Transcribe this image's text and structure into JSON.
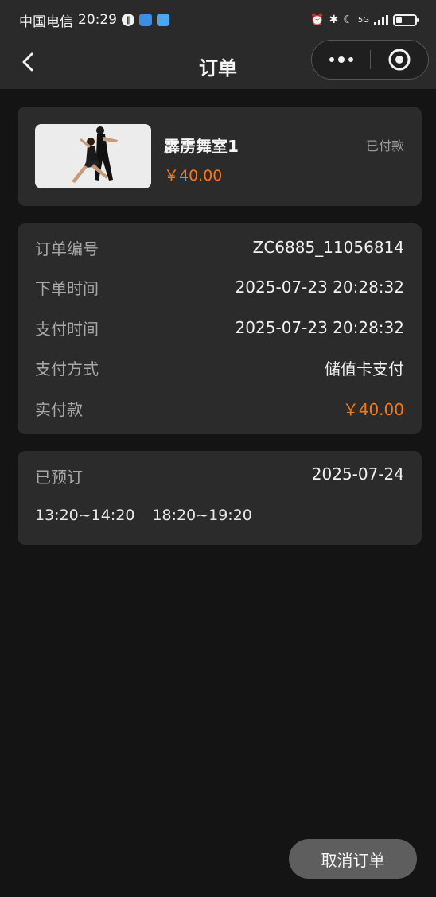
{
  "status_bar": {
    "carrier": "中国电信",
    "time": "20:29",
    "network": "5G"
  },
  "nav": {
    "title": "订单",
    "back_icon": "chevron-left-icon",
    "more_icon": "more-dots-icon",
    "close_icon": "target-circle-icon"
  },
  "product": {
    "name": "霹雳舞室1",
    "price": "￥40.00",
    "status": "已付款",
    "image_icon": "dancers-photo"
  },
  "order_info": {
    "rows": [
      {
        "label": "订单编号",
        "value": "ZC6885_11056814"
      },
      {
        "label": "下单时间",
        "value": "2025-07-23 20:28:32"
      },
      {
        "label": "支付时间",
        "value": "2025-07-23 20:28:32"
      },
      {
        "label": "支付方式",
        "value": "储值卡支付"
      },
      {
        "label": "实付款",
        "value": "￥40.00"
      }
    ]
  },
  "booking": {
    "label": "已预订",
    "date": "2025-07-24",
    "slots": [
      "13:20~14:20",
      "18:20~19:20"
    ]
  },
  "actions": {
    "cancel_label": "取消订单"
  },
  "colors": {
    "accent": "#f07a1c",
    "background": "#141414",
    "card": "#2b2b2b"
  }
}
